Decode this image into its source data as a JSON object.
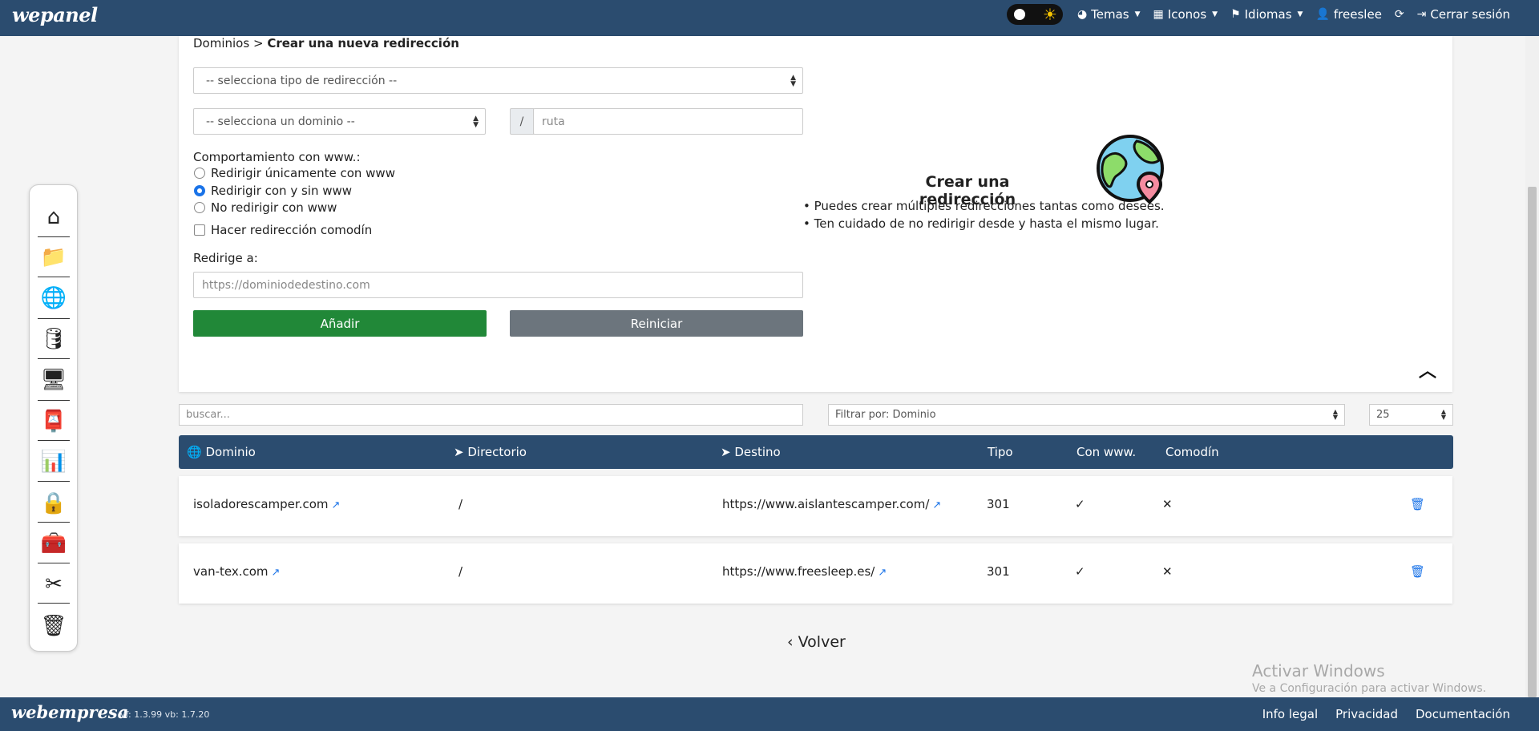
{
  "topbar": {
    "brand": "wepanel",
    "temas": "Temas",
    "iconos": "Iconos",
    "idiomas": "Idiomas",
    "user": "freeslee",
    "logout": "Cerrar sesión"
  },
  "breadcrumb": {
    "parent": "Dominios",
    "separator": ">",
    "current": "Crear una nueva redirección"
  },
  "form": {
    "redirect_type_placeholder": "-- selecciona tipo de redirección --",
    "domain_placeholder": "-- selecciona un dominio --",
    "path_prefix": "/",
    "path_placeholder": "ruta",
    "www_behavior_label": "Comportamiento con www.:",
    "radio_only_www": "Redirigir únicamente con www",
    "radio_with_without": "Redirigir con y sin www",
    "radio_no_www": "No redirigir con www",
    "wildcard_label": "Hacer redirección comodín",
    "redirect_to_label": "Redirige a:",
    "redirect_to_placeholder": "https://dominiodedestino.com",
    "add_button": "Añadir",
    "reset_button": "Reiniciar"
  },
  "info": {
    "title": "Crear una redirección",
    "bullets": [
      "Puedes crear múltiples redirecciones tantas como desees.",
      "Ten cuidado de no redirigir desde y hasta el mismo lugar."
    ]
  },
  "filters": {
    "search_placeholder": "buscar...",
    "filter_by": "Filtrar por: Dominio",
    "per_page": "25"
  },
  "table": {
    "headers": {
      "domain": "Dominio",
      "directory": "Directorio",
      "destination": "Destino",
      "type": "Tipo",
      "with_www": "Con www.",
      "wildcard": "Comodín"
    },
    "rows": [
      {
        "domain": "isoladorescamper.com",
        "directory": "/",
        "destination": "https://www.aislantescamper.com/",
        "type": "301",
        "with_www": "✓",
        "wildcard": "✕"
      },
      {
        "domain": "van-tex.com",
        "directory": "/",
        "destination": "https://www.freesleep.es/",
        "type": "301",
        "with_www": "✓",
        "wildcard": "✕"
      }
    ]
  },
  "volver": "Volver",
  "watermark": {
    "line1": "Activar Windows",
    "line2": "Ve a Configuración para activar Windows."
  },
  "footer": {
    "brand": "webempresa",
    "version": "vf: 1.3.99 vb: 1.7.20",
    "links": [
      "Info legal",
      "Privacidad",
      "Documentación"
    ]
  },
  "colors": {
    "nav": "#2b4c6f",
    "add": "#218838",
    "reset": "#6c757d",
    "link": "#1a73e8"
  }
}
